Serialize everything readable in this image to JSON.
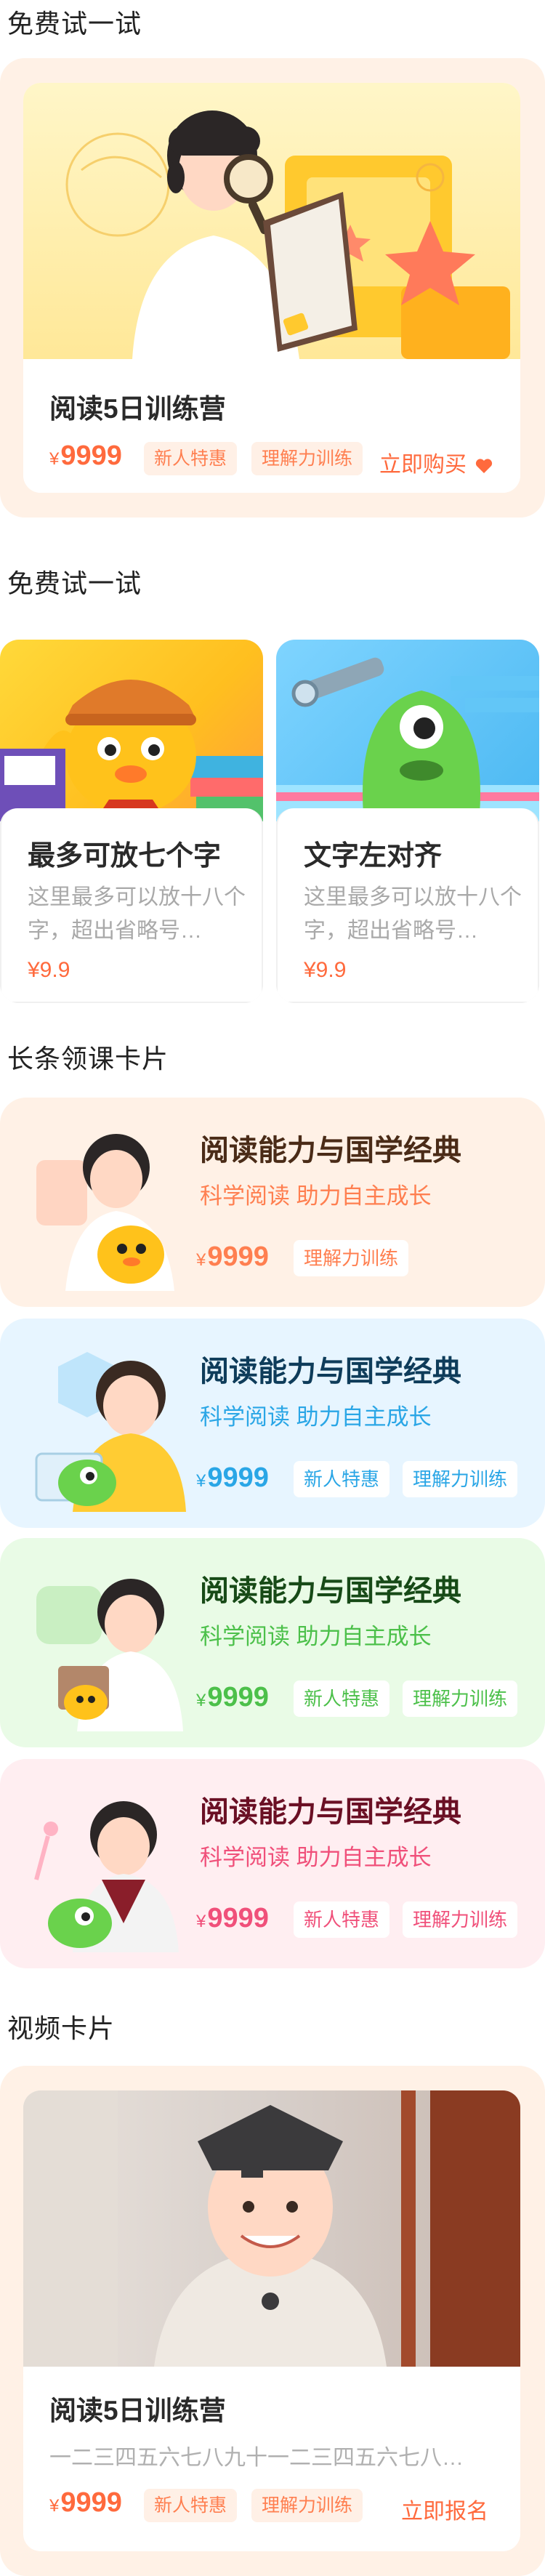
{
  "section1": {
    "title": "免费试一试",
    "card": {
      "title": "阅读5日训练营",
      "currency": "¥",
      "price": "9999",
      "tags": [
        "新人特惠",
        "理解力训练"
      ],
      "action": "立即购买",
      "action_icon": "heart-icon"
    }
  },
  "section2": {
    "title": "免费试一试",
    "cards": [
      {
        "title": "最多可放七个字",
        "desc": "这里最多可以放十八个字，超出省略号…",
        "price": "¥9.9"
      },
      {
        "title": "文字左对齐",
        "desc": "这里最多可以放十八个字，超出省略号…",
        "price": "¥9.9"
      }
    ]
  },
  "section3": {
    "title": "长条领课卡片",
    "cards": [
      {
        "title": "阅读能力与国学经典",
        "subtitle": "科学阅读  助力自主成长",
        "currency": "¥",
        "price": "9999",
        "tags": [
          "理解力训练"
        ],
        "theme": "#ff7f50"
      },
      {
        "title": "阅读能力与国学经典",
        "subtitle": "科学阅读  助力自主成长",
        "currency": "¥",
        "price": "9999",
        "tags": [
          "新人特惠",
          "理解力训练"
        ],
        "theme": "#2aa6e6"
      },
      {
        "title": "阅读能力与国学经典",
        "subtitle": "科学阅读  助力自主成长",
        "currency": "¥",
        "price": "9999",
        "tags": [
          "新人特惠",
          "理解力训练"
        ],
        "theme": "#4cc04a"
      },
      {
        "title": "阅读能力与国学经典",
        "subtitle": "科学阅读  助力自主成长",
        "currency": "¥",
        "price": "9999",
        "tags": [
          "新人特惠",
          "理解力训练"
        ],
        "theme": "#f0507a"
      }
    ]
  },
  "section4": {
    "title": "视频卡片",
    "card": {
      "title": "阅读5日训练营",
      "desc": "一二三四五六七八九十一二三四五六七八…",
      "currency": "¥",
      "price": "9999",
      "tags": [
        "新人特惠",
        "理解力训练"
      ],
      "action": "立即报名"
    }
  },
  "colors": {
    "accent": "#ff6a3d",
    "card_bg_warm": "#fff1e6",
    "text_primary": "#2a2a2a",
    "text_muted": "#a9a9a9"
  }
}
